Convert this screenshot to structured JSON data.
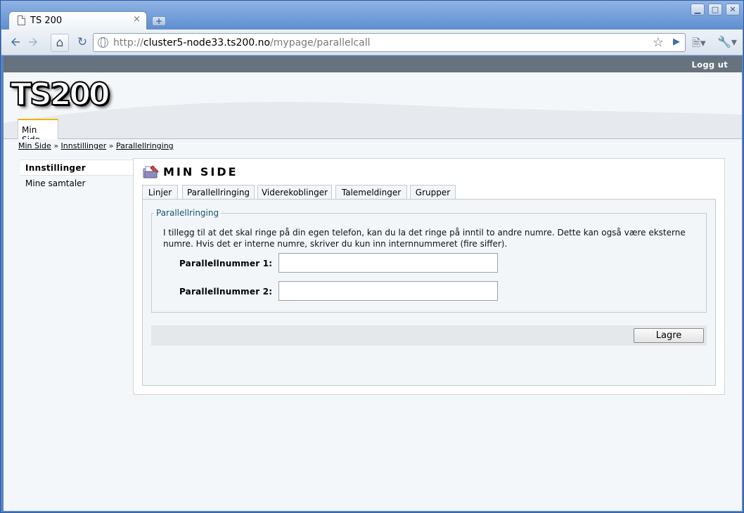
{
  "browser": {
    "tab_title": "TS 200",
    "tab_close": "×",
    "new_tab": "+",
    "url_prefix": "http://",
    "url_host": "cluster5-node33.ts200.no",
    "url_path": "/mypage/parallelcall",
    "window_buttons": {
      "minimize": "▁",
      "maximize": "□",
      "close": "✕"
    }
  },
  "topbar": {
    "logout": "Logg ut"
  },
  "header": {
    "logo": "TS200",
    "main_tab": "Min Side"
  },
  "breadcrumb": {
    "items": [
      "Min Side",
      "Innstillinger",
      "Parallellringing"
    ],
    "separator": "»"
  },
  "sidemenu": {
    "items": [
      "Innstillinger",
      "Mine samtaler"
    ]
  },
  "panel": {
    "title": "MIN SIDE",
    "tabs": [
      "Linjer",
      "Parallellringing",
      "Viderekoblinger",
      "Talemeldinger",
      "Grupper"
    ],
    "selected_tab": "Parallellringing",
    "fieldset_legend": "Parallellringing",
    "description": "I tillegg til at det skal ringe på din egen telefon, kan du la det ringe på inntil to andre numre. Dette kan også være eksterne numre. Hvis det er interne numre, skriver du kun inn internnummeret (fire siffer).",
    "field1_label": "Parallellnummer 1:",
    "field1_value": "",
    "field2_label": "Parallellnummer 2:",
    "field2_value": "",
    "save_label": "Lagre"
  }
}
